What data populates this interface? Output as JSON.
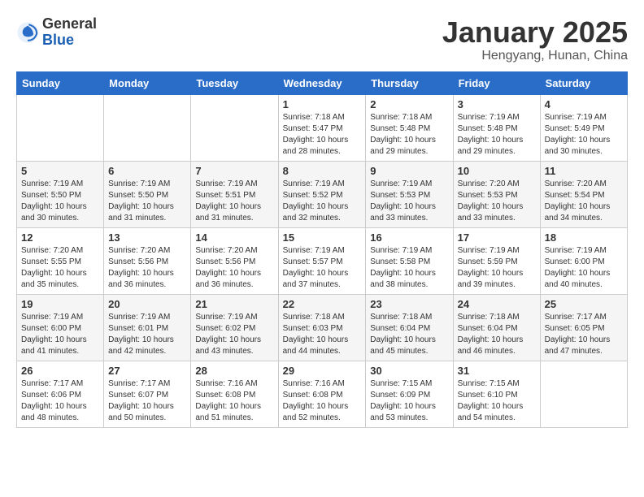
{
  "header": {
    "logo": {
      "general": "General",
      "blue": "Blue"
    },
    "month_title": "January 2025",
    "location": "Hengyang, Hunan, China"
  },
  "calendar": {
    "days_of_week": [
      "Sunday",
      "Monday",
      "Tuesday",
      "Wednesday",
      "Thursday",
      "Friday",
      "Saturday"
    ],
    "weeks": [
      [
        {
          "day": "",
          "info": ""
        },
        {
          "day": "",
          "info": ""
        },
        {
          "day": "",
          "info": ""
        },
        {
          "day": "1",
          "info": "Sunrise: 7:18 AM\nSunset: 5:47 PM\nDaylight: 10 hours\nand 28 minutes."
        },
        {
          "day": "2",
          "info": "Sunrise: 7:18 AM\nSunset: 5:48 PM\nDaylight: 10 hours\nand 29 minutes."
        },
        {
          "day": "3",
          "info": "Sunrise: 7:19 AM\nSunset: 5:48 PM\nDaylight: 10 hours\nand 29 minutes."
        },
        {
          "day": "4",
          "info": "Sunrise: 7:19 AM\nSunset: 5:49 PM\nDaylight: 10 hours\nand 30 minutes."
        }
      ],
      [
        {
          "day": "5",
          "info": "Sunrise: 7:19 AM\nSunset: 5:50 PM\nDaylight: 10 hours\nand 30 minutes."
        },
        {
          "day": "6",
          "info": "Sunrise: 7:19 AM\nSunset: 5:50 PM\nDaylight: 10 hours\nand 31 minutes."
        },
        {
          "day": "7",
          "info": "Sunrise: 7:19 AM\nSunset: 5:51 PM\nDaylight: 10 hours\nand 31 minutes."
        },
        {
          "day": "8",
          "info": "Sunrise: 7:19 AM\nSunset: 5:52 PM\nDaylight: 10 hours\nand 32 minutes."
        },
        {
          "day": "9",
          "info": "Sunrise: 7:19 AM\nSunset: 5:53 PM\nDaylight: 10 hours\nand 33 minutes."
        },
        {
          "day": "10",
          "info": "Sunrise: 7:20 AM\nSunset: 5:53 PM\nDaylight: 10 hours\nand 33 minutes."
        },
        {
          "day": "11",
          "info": "Sunrise: 7:20 AM\nSunset: 5:54 PM\nDaylight: 10 hours\nand 34 minutes."
        }
      ],
      [
        {
          "day": "12",
          "info": "Sunrise: 7:20 AM\nSunset: 5:55 PM\nDaylight: 10 hours\nand 35 minutes."
        },
        {
          "day": "13",
          "info": "Sunrise: 7:20 AM\nSunset: 5:56 PM\nDaylight: 10 hours\nand 36 minutes."
        },
        {
          "day": "14",
          "info": "Sunrise: 7:20 AM\nSunset: 5:56 PM\nDaylight: 10 hours\nand 36 minutes."
        },
        {
          "day": "15",
          "info": "Sunrise: 7:19 AM\nSunset: 5:57 PM\nDaylight: 10 hours\nand 37 minutes."
        },
        {
          "day": "16",
          "info": "Sunrise: 7:19 AM\nSunset: 5:58 PM\nDaylight: 10 hours\nand 38 minutes."
        },
        {
          "day": "17",
          "info": "Sunrise: 7:19 AM\nSunset: 5:59 PM\nDaylight: 10 hours\nand 39 minutes."
        },
        {
          "day": "18",
          "info": "Sunrise: 7:19 AM\nSunset: 6:00 PM\nDaylight: 10 hours\nand 40 minutes."
        }
      ],
      [
        {
          "day": "19",
          "info": "Sunrise: 7:19 AM\nSunset: 6:00 PM\nDaylight: 10 hours\nand 41 minutes."
        },
        {
          "day": "20",
          "info": "Sunrise: 7:19 AM\nSunset: 6:01 PM\nDaylight: 10 hours\nand 42 minutes."
        },
        {
          "day": "21",
          "info": "Sunrise: 7:19 AM\nSunset: 6:02 PM\nDaylight: 10 hours\nand 43 minutes."
        },
        {
          "day": "22",
          "info": "Sunrise: 7:18 AM\nSunset: 6:03 PM\nDaylight: 10 hours\nand 44 minutes."
        },
        {
          "day": "23",
          "info": "Sunrise: 7:18 AM\nSunset: 6:04 PM\nDaylight: 10 hours\nand 45 minutes."
        },
        {
          "day": "24",
          "info": "Sunrise: 7:18 AM\nSunset: 6:04 PM\nDaylight: 10 hours\nand 46 minutes."
        },
        {
          "day": "25",
          "info": "Sunrise: 7:17 AM\nSunset: 6:05 PM\nDaylight: 10 hours\nand 47 minutes."
        }
      ],
      [
        {
          "day": "26",
          "info": "Sunrise: 7:17 AM\nSunset: 6:06 PM\nDaylight: 10 hours\nand 48 minutes."
        },
        {
          "day": "27",
          "info": "Sunrise: 7:17 AM\nSunset: 6:07 PM\nDaylight: 10 hours\nand 50 minutes."
        },
        {
          "day": "28",
          "info": "Sunrise: 7:16 AM\nSunset: 6:08 PM\nDaylight: 10 hours\nand 51 minutes."
        },
        {
          "day": "29",
          "info": "Sunrise: 7:16 AM\nSunset: 6:08 PM\nDaylight: 10 hours\nand 52 minutes."
        },
        {
          "day": "30",
          "info": "Sunrise: 7:15 AM\nSunset: 6:09 PM\nDaylight: 10 hours\nand 53 minutes."
        },
        {
          "day": "31",
          "info": "Sunrise: 7:15 AM\nSunset: 6:10 PM\nDaylight: 10 hours\nand 54 minutes."
        },
        {
          "day": "",
          "info": ""
        }
      ]
    ]
  }
}
